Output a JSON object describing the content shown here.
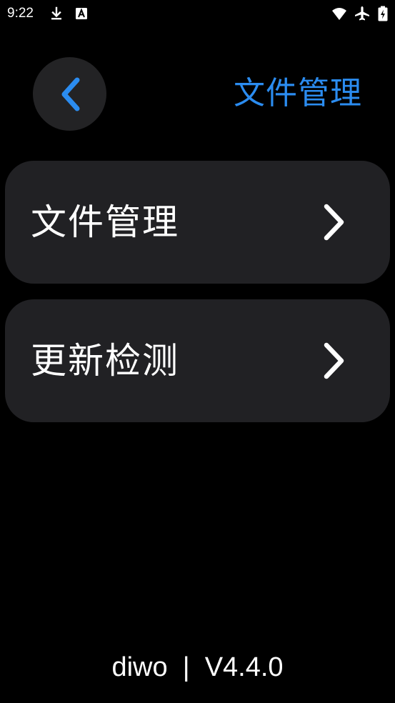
{
  "status_bar": {
    "time": "9:22",
    "icons": [
      "download-icon",
      "a-notification-icon",
      "wifi-icon",
      "airplane-icon",
      "battery-charging-icon"
    ]
  },
  "header": {
    "back_icon": "chevron-left-icon",
    "title": "文件管理"
  },
  "menu": {
    "items": [
      {
        "label": "文件管理",
        "icon": "chevron-right-icon"
      },
      {
        "label": "更新检测",
        "icon": "chevron-right-icon"
      }
    ]
  },
  "footer": {
    "text": "diwo  |  V4.4.0"
  },
  "colors": {
    "background": "#000000",
    "card": "#212124",
    "back_button": "#232325",
    "accent": "#2b8cf0",
    "text": "#ffffff"
  }
}
